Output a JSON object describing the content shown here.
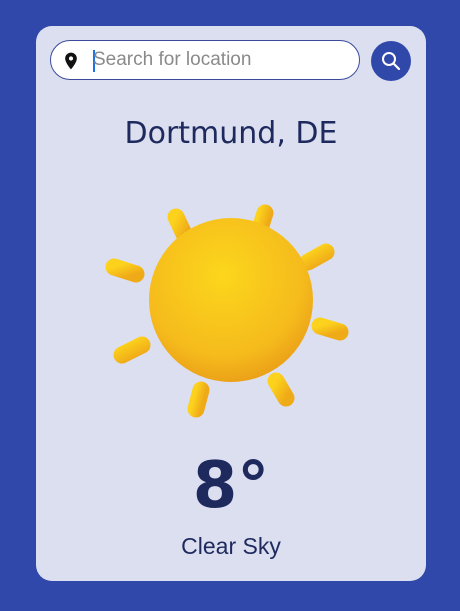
{
  "search": {
    "placeholder": "Search for location",
    "value": ""
  },
  "icons": {
    "location": "map-pin-icon",
    "search": "magnifier-icon",
    "weather": "sun-icon"
  },
  "weather": {
    "location": "Dortmund, DE",
    "temperature": "8°",
    "condition": "Clear Sky"
  },
  "colors": {
    "background": "#3148ab",
    "card": "#dcdfef",
    "text": "#1e2a5e",
    "sun": "#f7c21a"
  }
}
